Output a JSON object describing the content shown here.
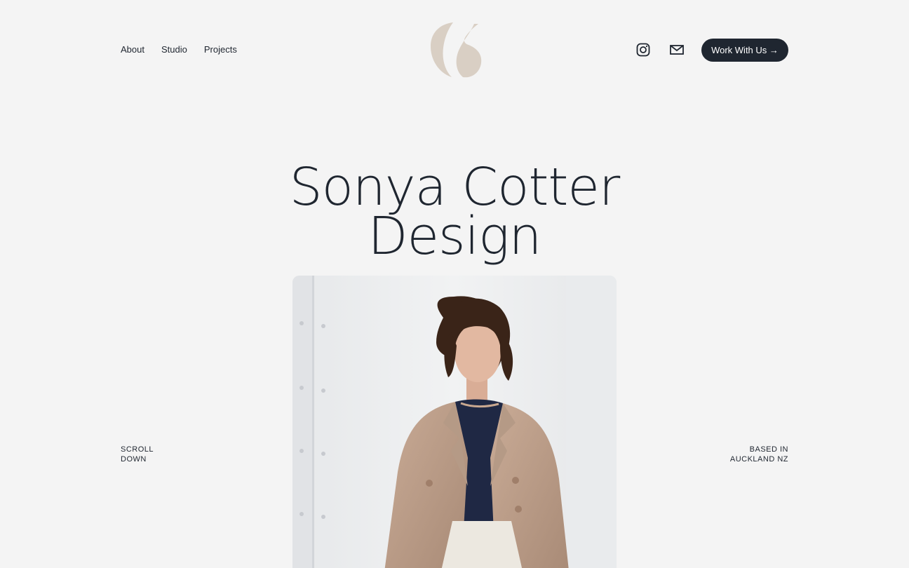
{
  "nav": {
    "items": [
      {
        "label": "About"
      },
      {
        "label": "Studio"
      },
      {
        "label": "Projects"
      }
    ]
  },
  "header": {
    "cta_label": "Work With Us →",
    "social": [
      "instagram-icon",
      "mail-icon"
    ]
  },
  "hero": {
    "title_line1": "Sonya Cotter",
    "title_line2": "Design"
  },
  "captions": {
    "left_line1": "SCROLL",
    "left_line2": "DOWN",
    "right_line1": "BASED IN",
    "right_line2": "AUCKLAND NZ"
  },
  "colors": {
    "background": "#f4f4f4",
    "text": "#1f2630",
    "logo": "#d9cfc4",
    "cta_bg": "#1f2630"
  }
}
